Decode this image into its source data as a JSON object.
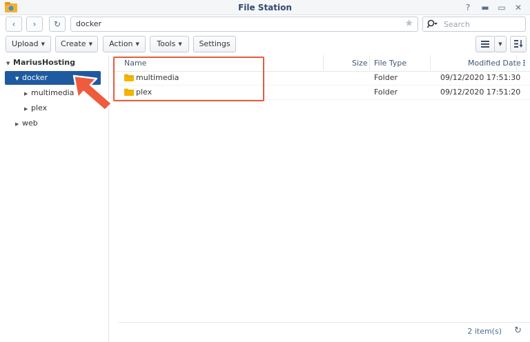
{
  "window": {
    "title": "File Station",
    "help_glyph": "?",
    "minimize_glyph": "▬",
    "maximize_glyph": "▭",
    "close_glyph": "✕"
  },
  "nav": {
    "back_glyph": "‹",
    "forward_glyph": "›",
    "refresh_glyph": "↻",
    "path": "docker",
    "search_placeholder": "Search"
  },
  "toolbar": {
    "upload": "Upload",
    "create": "Create",
    "action": "Action",
    "tools": "Tools",
    "settings": "Settings"
  },
  "tree": {
    "root": "MariusHosting",
    "items": [
      {
        "label": "docker"
      },
      {
        "label": "multimedia"
      },
      {
        "label": "plex"
      },
      {
        "label": "web"
      }
    ]
  },
  "list": {
    "columns": {
      "name": "Name",
      "size": "Size",
      "type": "File Type",
      "modified": "Modified Date"
    },
    "rows": [
      {
        "name": "multimedia",
        "size": "",
        "type": "Folder",
        "modified": "09/12/2020 17:51:30"
      },
      {
        "name": "plex",
        "size": "",
        "type": "Folder",
        "modified": "09/12/2020 17:51:20"
      }
    ]
  },
  "status": {
    "count": "2 item(s)"
  },
  "colors": {
    "accent": "#1f5aa0",
    "highlight": "#e85a3c",
    "folder": "#f5b400"
  }
}
